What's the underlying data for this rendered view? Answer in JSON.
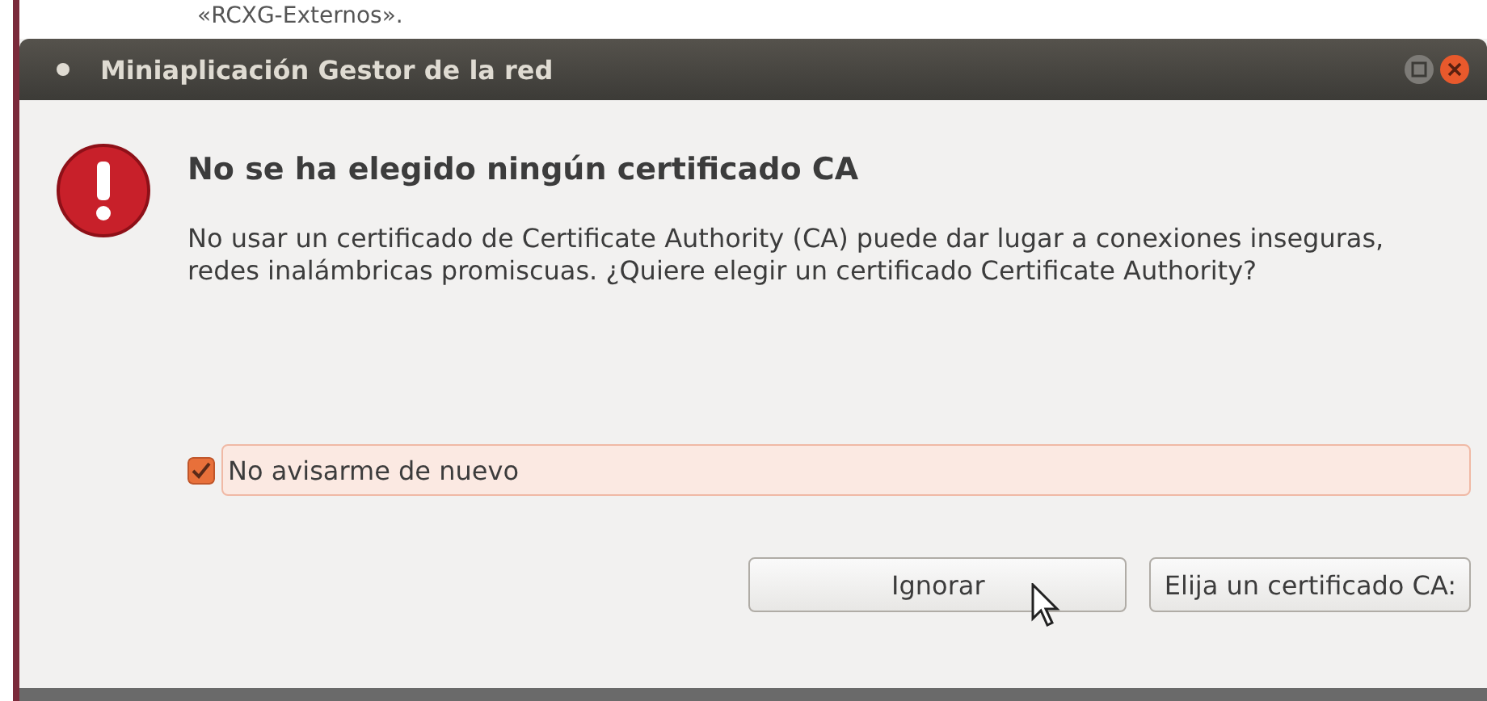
{
  "background_text": "«RCXG-Externos».",
  "window": {
    "title": "Miniaplicación Gestor de la red"
  },
  "dialog": {
    "heading": "No se ha elegido ningún certificado CA",
    "message": "No usar un certificado de Certificate Authority (CA) puede dar lugar a conexiones inseguras, redes inalámbricas promiscuas. ¿Quiere elegir un certificado Certificate Authority?",
    "checkbox": {
      "label": "No avisarme de nuevo",
      "checked": true,
      "focused": true
    },
    "buttons": [
      "Ignorar",
      "Elija un certificado CA:"
    ]
  }
}
